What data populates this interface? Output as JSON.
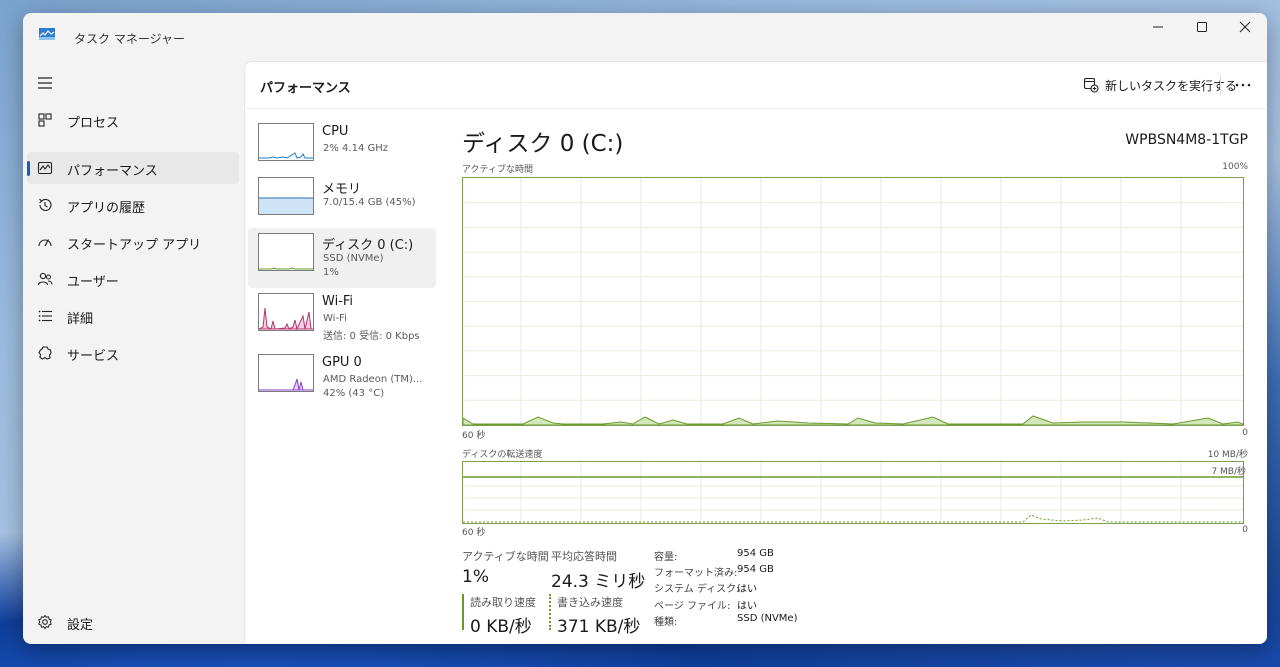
{
  "window": {
    "title": "タスク マネージャー"
  },
  "sidebar": {
    "items": [
      {
        "label": "プロセス",
        "icon": "processes-icon"
      },
      {
        "label": "パフォーマンス",
        "icon": "performance-icon"
      },
      {
        "label": "アプリの履歴",
        "icon": "app-history-icon"
      },
      {
        "label": "スタートアップ アプリ",
        "icon": "startup-icon"
      },
      {
        "label": "ユーザー",
        "icon": "users-icon"
      },
      {
        "label": "詳細",
        "icon": "details-icon"
      },
      {
        "label": "サービス",
        "icon": "services-icon"
      }
    ],
    "settings_label": "設定"
  },
  "header": {
    "title": "パフォーマンス",
    "run_task_label": "新しいタスクを実行する"
  },
  "devices": [
    {
      "name": "CPU",
      "sub": "2%  4.14 GHz",
      "sub2": ""
    },
    {
      "name": "メモリ",
      "sub": "7.0/15.4 GB (45%)",
      "sub2": ""
    },
    {
      "name": "ディスク 0 (C:)",
      "sub": "SSD (NVMe)",
      "sub2": "1%"
    },
    {
      "name": "Wi-Fi",
      "sub": "Wi-Fi",
      "sub2": "送信: 0 受信: 0 Kbps"
    },
    {
      "name": "GPU 0",
      "sub": "AMD Radeon (TM)...",
      "sub2": "42% (43 °C)"
    }
  ],
  "detail": {
    "title": "ディスク 0 (C:)",
    "model": "WPBSN4M8-1TGP",
    "graph1": {
      "label": "アクティブな時間",
      "max": "100%",
      "left_axis": "60 秒",
      "right_axis": "0"
    },
    "graph2": {
      "label": "ディスクの転送速度",
      "max": "10 MB/秒",
      "ref_line": "7 MB/秒",
      "left_axis": "60 秒",
      "right_axis": "0"
    },
    "stats": {
      "active_label": "アクティブな時間",
      "active_value": "1%",
      "resp_label": "平均応答時間",
      "resp_value": "24.3 ミリ秒",
      "read_label": "読み取り速度",
      "read_value": "0 KB/秒",
      "write_label": "書き込み速度",
      "write_value": "371 KB/秒"
    },
    "props": [
      {
        "key": "容量:",
        "value": "954 GB"
      },
      {
        "key": "フォーマット済み:",
        "value": "954 GB"
      },
      {
        "key": "システム ディスク:",
        "value": "はい"
      },
      {
        "key": "ページ ファイル:",
        "value": "はい"
      },
      {
        "key": "種類:",
        "value": "SSD (NVMe)"
      }
    ]
  },
  "colors": {
    "accent": "#1a5fb4",
    "disk_green": "#6b9a2a",
    "cpu_blue": "#1f7ec9",
    "wifi_pink": "#b8316d",
    "gpu_purple": "#8a3fc9",
    "memory_fill": "#cfe3f8"
  }
}
